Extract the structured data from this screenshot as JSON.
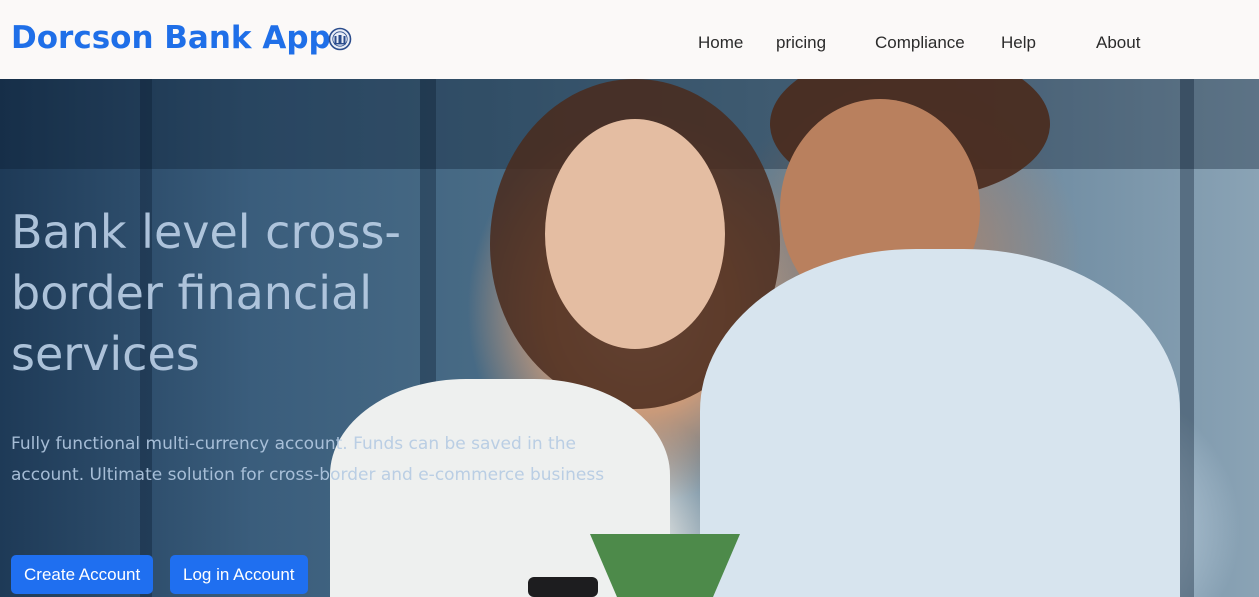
{
  "nav": {
    "brand": "Dorcson Bank App",
    "logo_icon": "bank-seal-icon",
    "links": [
      {
        "label": "Home"
      },
      {
        "label": "pricing"
      },
      {
        "label": "Compliance"
      },
      {
        "label": "Help"
      },
      {
        "label": "About"
      }
    ]
  },
  "hero": {
    "headline": "Bank level cross-border financial services",
    "subtext": "Fully functional multi-currency account. Funds can be saved in the account. Ultimate solution for cross-border and e-commerce business",
    "buttons": {
      "create_label": "Create Account",
      "login_label": "Log in Account"
    },
    "image_description_icon": "hero-photo-icon"
  },
  "colors": {
    "brand": "#1f6fe8",
    "button": "#1f6ff0",
    "navbar_bg": "#fbf9f8",
    "headline": "#b8cde4"
  }
}
